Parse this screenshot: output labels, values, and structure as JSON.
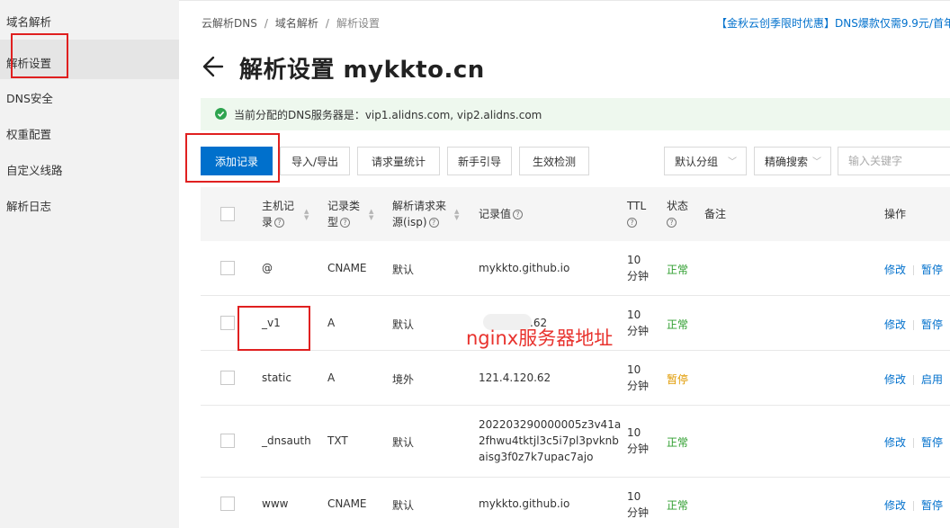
{
  "sidebar": {
    "items": [
      {
        "label": "域名解析"
      },
      {
        "label": "解析设置"
      },
      {
        "label": "DNS安全"
      },
      {
        "label": "权重配置"
      },
      {
        "label": "自定义线路"
      },
      {
        "label": "解析日志"
      }
    ]
  },
  "breadcrumb": [
    "云解析DNS",
    "域名解析",
    "解析设置"
  ],
  "breadcrumb_sep": "/",
  "promo": "【金秋云创季限时优惠】DNS爆款仅需9.9元/首年",
  "page_title": "解析设置 mykkto.cn",
  "notice": "当前分配的DNS服务器是：vip1.alidns.com, vip2.alidns.com",
  "toolbar": {
    "add": "添加记录",
    "import_export": "导入/导出",
    "request_stats": "请求量统计",
    "guide": "新手引导",
    "check": "生效检测",
    "group_select": "默认分组",
    "search_mode": "精确搜索",
    "search_placeholder": "输入关键字"
  },
  "table": {
    "headers": {
      "host_1": "主机记",
      "host_2": "录",
      "type_1": "记录类",
      "type_2": "型",
      "line_1": "解析请求来",
      "line_2": "源(isp)",
      "value": "记录值",
      "ttl": "TTL",
      "status": "状态",
      "remark": "备注",
      "action": "操作"
    },
    "ttl_unit": "分钟",
    "rows": [
      {
        "host": "@",
        "type": "CNAME",
        "line": "默认",
        "value": "mykkto.github.io",
        "ttl": "10",
        "status": "正常",
        "action1": "修改",
        "action2": "暂停"
      },
      {
        "host": "_v1",
        "type": "A",
        "line": "默认",
        "value": ".62",
        "ttl": "10",
        "status": "正常",
        "action1": "修改",
        "action2": "暂停"
      },
      {
        "host": "static",
        "type": "A",
        "line": "境外",
        "value": "121.4.120.62",
        "ttl": "10",
        "status": "暂停",
        "action1": "修改",
        "action2": "启用"
      },
      {
        "host": "_dnsauth",
        "type": "TXT",
        "line": "默认",
        "value_lines": [
          "202203290000005z3v41a",
          "2fhwu4tktjl3c5i7pl3pvknb",
          "aisg3f0z7k7upac7ajo"
        ],
        "ttl": "10",
        "status": "正常",
        "action1": "修改",
        "action2": "暂停"
      },
      {
        "host": "www",
        "type": "CNAME",
        "line": "默认",
        "value": "mykkto.github.io",
        "ttl": "10",
        "status": "正常",
        "action1": "修改",
        "action2": "暂停"
      }
    ]
  },
  "annotation": "nginx服务器地址",
  "colors": {
    "primary": "#0070cc",
    "status_ok": "#2e9e2e",
    "status_paused": "#e09a00",
    "annotation_red": "#e8322d",
    "notice_bg": "#eef8ee"
  }
}
